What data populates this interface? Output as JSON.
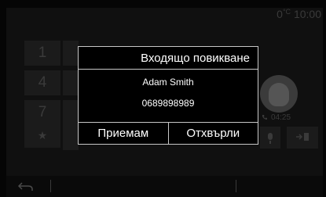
{
  "status_bar": {
    "temp": "0",
    "temp_unit": "°C",
    "time": "10:00"
  },
  "keypad": {
    "keys": [
      "1",
      "4",
      "7",
      "★"
    ]
  },
  "active_call": {
    "duration": "04:25"
  },
  "dialog": {
    "title": "Входящо повикване",
    "caller_name": "Adam Smith",
    "caller_number": "0689898989",
    "accept_label": "Приемам",
    "reject_label": "Отхвърли"
  },
  "colors": {
    "dialog_border": "#c8c8c8",
    "background": "#101010",
    "dim_text": "#3a3a3a"
  },
  "icons": [
    "back-icon",
    "phone-icon",
    "avatar-icon",
    "microphone-icon",
    "transfer-icon"
  ]
}
